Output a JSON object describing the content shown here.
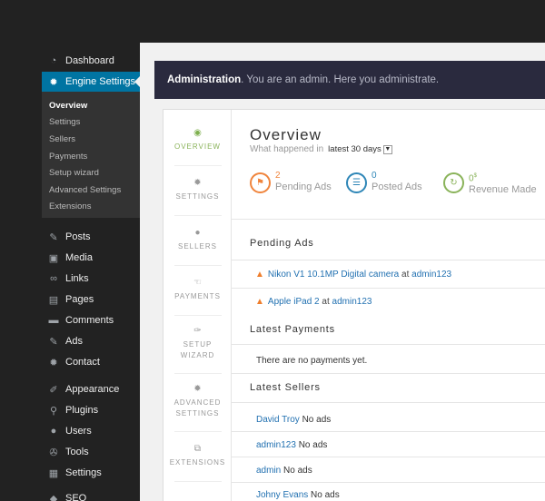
{
  "sidebar": {
    "top_items": [
      {
        "label": "Dashboard",
        "icon": "dashboard-icon"
      },
      {
        "label": "Engine Settings",
        "icon": "gear-icon",
        "active": true
      }
    ],
    "submenu": [
      "Overview",
      "Settings",
      "Sellers",
      "Payments",
      "Setup wizard",
      "Advanced Settings",
      "Extensions"
    ],
    "items": [
      {
        "label": "Posts",
        "icon": "pin-icon"
      },
      {
        "label": "Media",
        "icon": "media-icon"
      },
      {
        "label": "Links",
        "icon": "link-icon"
      },
      {
        "label": "Pages",
        "icon": "pages-icon"
      },
      {
        "label": "Comments",
        "icon": "comment-icon"
      },
      {
        "label": "Ads",
        "icon": "pin-icon"
      },
      {
        "label": "Contact",
        "icon": "gear-icon"
      },
      {
        "label": "Appearance",
        "icon": "brush-icon"
      },
      {
        "label": "Plugins",
        "icon": "plugin-icon"
      },
      {
        "label": "Users",
        "icon": "user-icon"
      },
      {
        "label": "Tools",
        "icon": "wrench-icon"
      },
      {
        "label": "Settings",
        "icon": "settings-icon"
      },
      {
        "label": "SEO",
        "icon": "seo-icon"
      }
    ]
  },
  "admin_bar": {
    "strong": "Administration",
    "text": ". You are an admin. Here you administrate."
  },
  "tabs": [
    {
      "label": "OVERVIEW",
      "icon": "overview-icon"
    },
    {
      "label": "SETTINGS",
      "icon": "gear-icon"
    },
    {
      "label": "SELLERS",
      "icon": "user-icon"
    },
    {
      "label": "PAYMENTS",
      "icon": "hand-icon"
    },
    {
      "label": "SETUP\nWIZARD",
      "icon": "wand-icon"
    },
    {
      "label": "ADVANCED\nSETTINGS",
      "icon": "gear-icon"
    },
    {
      "label": "EXTENSIONS",
      "icon": "extensions-icon"
    }
  ],
  "overview": {
    "title": "Overview",
    "subtitle": "What happened in",
    "period": "latest 30 days",
    "stats": [
      {
        "num": "2",
        "label": "Pending Ads",
        "color": "#f0843c"
      },
      {
        "num": "0",
        "label": "Posted Ads",
        "color": "#2e86b7"
      },
      {
        "num": "0",
        "sup": "$",
        "label": "Revenue Made",
        "color": "#8ab35a"
      }
    ]
  },
  "pending_ads": {
    "title": "Pending Ads",
    "items": [
      {
        "title": "Nikon V1 10.1MP Digital camera",
        "at": "at",
        "user": "admin123"
      },
      {
        "title": "Apple iPad 2",
        "at": "at",
        "user": "admin123"
      }
    ]
  },
  "latest_payments": {
    "title": "Latest Payments",
    "empty": "There are no payments yet."
  },
  "latest_sellers": {
    "title": "Latest Sellers",
    "items": [
      {
        "name": "David Troy",
        "ads": "No ads"
      },
      {
        "name": "admin123",
        "ads": "No ads"
      },
      {
        "name": "admin",
        "ads": "No ads"
      },
      {
        "name": "Johny Evans",
        "ads": "No ads"
      }
    ]
  }
}
